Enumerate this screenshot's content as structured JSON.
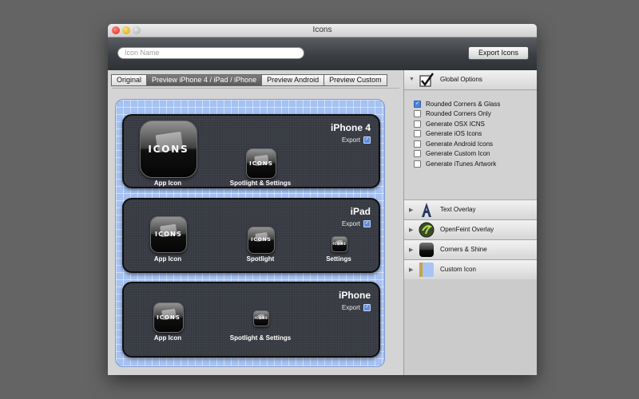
{
  "window": {
    "title": "Icons"
  },
  "toolbar": {
    "search_placeholder": "Icon Name",
    "export_label": "Export Icons"
  },
  "tabs": [
    {
      "label": "Original",
      "active": false
    },
    {
      "label": "Preview iPhone 4 / iPad / iPhone",
      "active": true
    },
    {
      "label": "Preview Android",
      "active": false
    },
    {
      "label": "Preview Custom",
      "active": false
    }
  ],
  "icon_text": "ICONS",
  "panels": [
    {
      "title": "iPhone 4",
      "export_label": "Export",
      "export_checked": true,
      "icons": [
        {
          "label": "App Icon"
        },
        {
          "label": "Spotlight & Settings"
        }
      ]
    },
    {
      "title": "iPad",
      "export_label": "Export",
      "export_checked": true,
      "icons": [
        {
          "label": "App Icon"
        },
        {
          "label": "Spotlight"
        },
        {
          "label": "Settings"
        }
      ]
    },
    {
      "title": "iPhone",
      "export_label": "Export",
      "export_checked": true,
      "icons": [
        {
          "label": "App Icon"
        },
        {
          "label": "Spotlight & Settings"
        }
      ]
    }
  ],
  "sidebar": {
    "global": {
      "label": "Global Options",
      "icon": "checkbox-icon"
    },
    "options": [
      {
        "label": "Rounded Corners & Glass",
        "checked": true
      },
      {
        "label": "Rounded Corners Only",
        "checked": false
      },
      {
        "label": "Generate OSX ICNS",
        "checked": false
      },
      {
        "label": "Generate iOS Icons",
        "checked": false
      },
      {
        "label": "Generate Android Icons",
        "checked": false
      },
      {
        "label": "Generate Custom Icon",
        "checked": false
      },
      {
        "label": "Generate iTunes Artwork",
        "checked": false
      }
    ],
    "sections": [
      {
        "label": "Text Overlay",
        "icon": "letter-a-icon"
      },
      {
        "label": "OpenFeint Overlay",
        "icon": "openfeint-icon"
      },
      {
        "label": "Corners & Shine",
        "icon": "corners-shine-icon"
      },
      {
        "label": "Custom Icon",
        "icon": "custom-icon-icon"
      }
    ]
  },
  "colors": {
    "grid_blue": "#a6c2f3",
    "panel_dark": "#3a3d45",
    "check_blue": "#4b86dd"
  }
}
